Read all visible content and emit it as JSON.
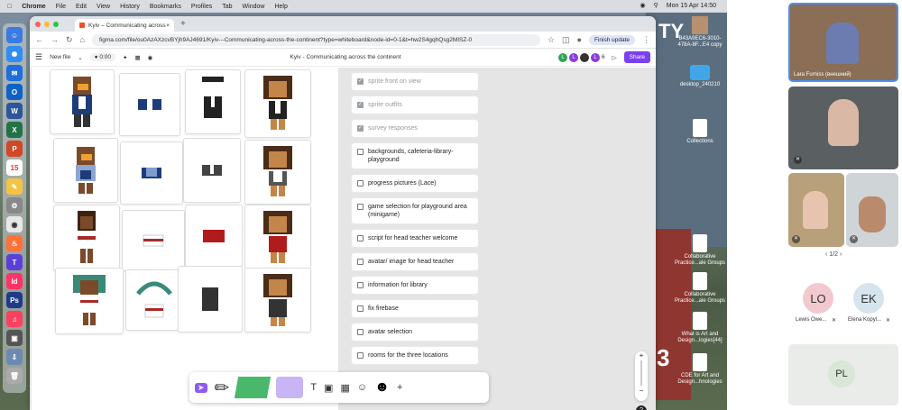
{
  "menubar": {
    "app": "Chrome",
    "items": [
      "File",
      "Edit",
      "View",
      "History",
      "Bookmarks",
      "Profiles",
      "Tab",
      "Window",
      "Help"
    ],
    "datetime": "Mon 15 Apr  14:50"
  },
  "browser": {
    "tab_title": "Kyiv – Communicating across",
    "url": "figma.com/file/ou0AzAXzcvBYjh9AJ4691/Kyiv---Communicating-across-the-continent?type=whiteboard&node-id=0-1&t=hw2S4gqhQsg2MISZ-0",
    "finish_update": "Finish update"
  },
  "figma": {
    "new_file": "New file",
    "zoom_badge": "0:00",
    "doc_title": "Kyiv - Communicating across the continent",
    "avatars": [
      {
        "initial": "L",
        "color": "#2aa65c"
      },
      {
        "initial": "L",
        "color": "#8a3be0"
      },
      {
        "initial": "",
        "color": "#333333"
      },
      {
        "initial": "L",
        "color": "#8a3be0"
      }
    ],
    "viewer_count": "6",
    "share": "Share"
  },
  "tasks": [
    {
      "label": "sprite front on view",
      "done": true
    },
    {
      "label": "sprite outfits",
      "done": true
    },
    {
      "label": "survey responses",
      "done": true
    },
    {
      "label": "backgrounds, cafeteria-library-playground",
      "done": false
    },
    {
      "label": "progress pictures (Lace)",
      "done": false
    },
    {
      "label": "game selection for playground area (minigame)",
      "done": false
    },
    {
      "label": "script for head teacher welcome",
      "done": false
    },
    {
      "label": "avatar/ image for head teacher",
      "done": false
    },
    {
      "label": "information for library",
      "done": false
    },
    {
      "label": "fix firebase",
      "done": false
    },
    {
      "label": "avatar selection",
      "done": false
    },
    {
      "label": "rooms for the three locations",
      "done": false
    }
  ],
  "desktop_items": [
    {
      "label": "B43A9EC6-3010-478A-8F...E4 copy",
      "kind": "image"
    },
    {
      "label": "desktop_240210",
      "kind": "folder"
    },
    {
      "label": "Collections",
      "kind": "doc"
    },
    {
      "label": "Collaborative Practice...ale Groups",
      "kind": "doc"
    },
    {
      "label": "Collaborative Practice...ale Groups",
      "kind": "doc"
    },
    {
      "label": "What is Art and Design...logies[44]",
      "kind": "doc"
    },
    {
      "label": "CDE for Art and Design...hnologies",
      "kind": "doc"
    }
  ],
  "meet": {
    "participants": [
      {
        "name": "Lara Furniss (внешний)"
      },
      {
        "name": ""
      },
      {
        "name": ""
      },
      {
        "name": ""
      }
    ],
    "pager": "1/2",
    "bubbles": [
      {
        "initials": "LO",
        "name": "Lewis Owe...",
        "color": "#f3c9d0"
      },
      {
        "initials": "EK",
        "name": "Elena Kopyl...",
        "color": "#d6e4ee"
      },
      {
        "initials": "PL",
        "name": "",
        "color": "#d8e7d6"
      }
    ]
  }
}
